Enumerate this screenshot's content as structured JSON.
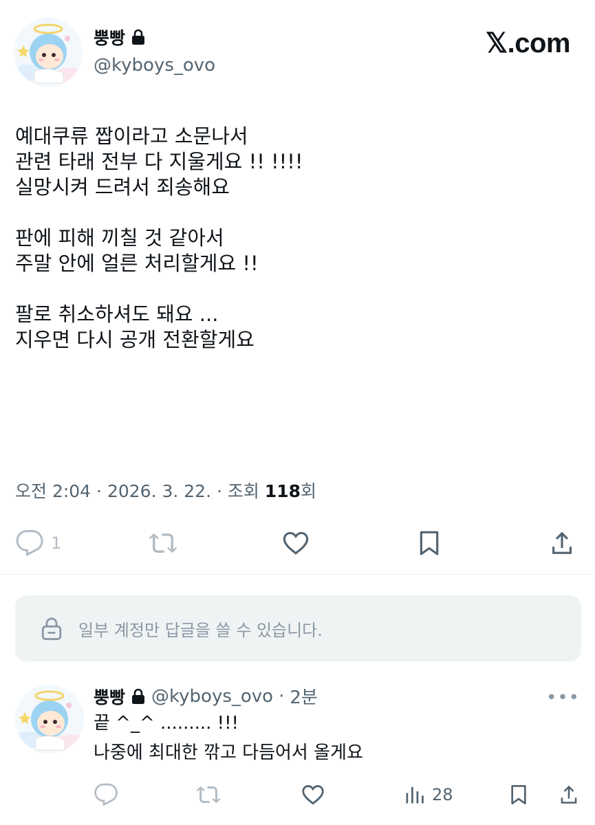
{
  "header": {
    "display_name": "뿡빵",
    "handle": "@kyboys_ovo",
    "brand": "𝕏.com"
  },
  "tweet": {
    "lines": [
      "예대쿠류 짭이라고 소문나서",
      "관련 타래 전부 다 지울게요 !! !!!!",
      "실망시켜 드려서 죄송해요",
      "",
      "판에 피해 끼칠 것 같아서",
      "주말 안에 얼른 처리할게요 !!",
      "",
      "팔로 취소하셔도 돼요 ...",
      "지우면 다시 공개 전환할게요"
    ],
    "meta": {
      "time": "오전 2:04",
      "date": "2026. 3. 22.",
      "views_prefix": "조회",
      "views": "118",
      "views_suffix": "회"
    },
    "actions": {
      "reply_count": "1"
    }
  },
  "reply_restriction": {
    "text": "일부 계정만 답글을 쓸 수 있습니다."
  },
  "reply": {
    "display_name": "뿡빵",
    "handle": "@kyboys_ovo",
    "time": "2분",
    "more": "•••",
    "lines": [
      "끝 ^_^ ......... !!!",
      "나중에 최대한 깎고 다듬어서 올게요"
    ],
    "views": "28"
  },
  "colors": {
    "text": "#0f1419",
    "secondary": "#536471",
    "muted": "#b3bcc4",
    "restriction_bg": "#eff3f4"
  }
}
